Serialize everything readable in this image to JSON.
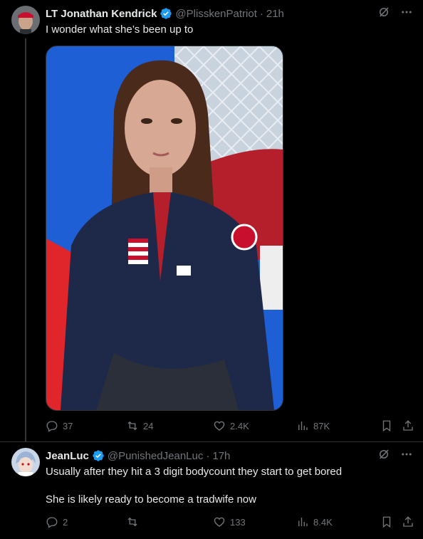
{
  "tweet1": {
    "author_name": "LT Jonathan Kendrick",
    "author_handle": "@PlisskenPatriot",
    "time": "21h",
    "text": "I wonder what she’s been up to",
    "image_alt": "Photo of a young woman in a navy USA team jacket sitting on a couch",
    "stats": {
      "replies": "37",
      "reposts": "24",
      "likes": "2.4K",
      "views": "87K"
    }
  },
  "tweet2": {
    "author_name": "JeanLuc",
    "author_handle": "@PunishedJeanLuc",
    "time": "17h",
    "text_line1": "Usually after they hit a 3 digit bodycount they start to get bored",
    "text_line2": "She is likely ready to become a tradwife now",
    "stats": {
      "replies": "2",
      "reposts": "",
      "likes": "133",
      "views": "8.4K"
    }
  },
  "separator_dot": "·",
  "icons": [
    "verified-badge-icon",
    "grok-icon",
    "more-icon",
    "reply-icon",
    "repost-icon",
    "like-icon",
    "views-icon",
    "bookmark-icon",
    "share-icon"
  ],
  "colors": {
    "background": "#000000",
    "text": "#e7e9ea",
    "muted": "#71767b",
    "verified": "#1d9bf0",
    "divider": "#2f3336"
  }
}
